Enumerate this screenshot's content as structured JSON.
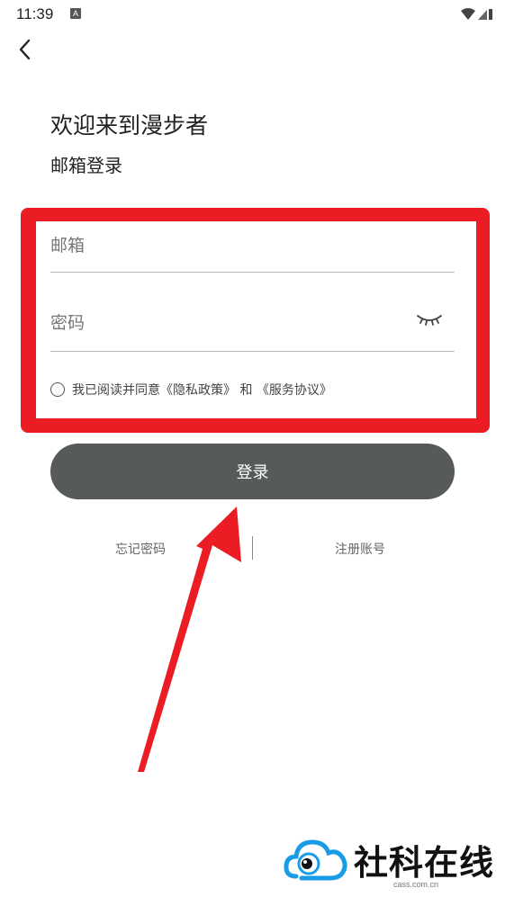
{
  "status_bar": {
    "time": "11:39",
    "notification_icon": "A",
    "icons": [
      "wifi-icon",
      "signal-icon",
      "battery-icon"
    ]
  },
  "header": {
    "back_icon": "chevron-left-icon",
    "title": "欢迎来到漫步者",
    "subtitle": "邮箱登录"
  },
  "form": {
    "email_placeholder": "邮箱",
    "password_placeholder": "密码",
    "password_toggle_icon": "eye-closed-icon",
    "agreement_prefix": "我已阅读并同意",
    "privacy_link": "《隐私政策》",
    "agreement_and": " 和 ",
    "service_link": "《服务协议》",
    "agreement_checked": false
  },
  "actions": {
    "login_label": "登录",
    "forgot_password": "忘记密码",
    "register": "注册账号"
  },
  "annotation": {
    "highlight_color": "#ec1c24",
    "arrow_color": "#ec1c24"
  },
  "watermark": {
    "text": "社科在线",
    "url": "cass.com.cn",
    "icon_color": "#1a9be6"
  },
  "colors": {
    "button_bg": "#575a5b",
    "background": "#ffffff"
  }
}
